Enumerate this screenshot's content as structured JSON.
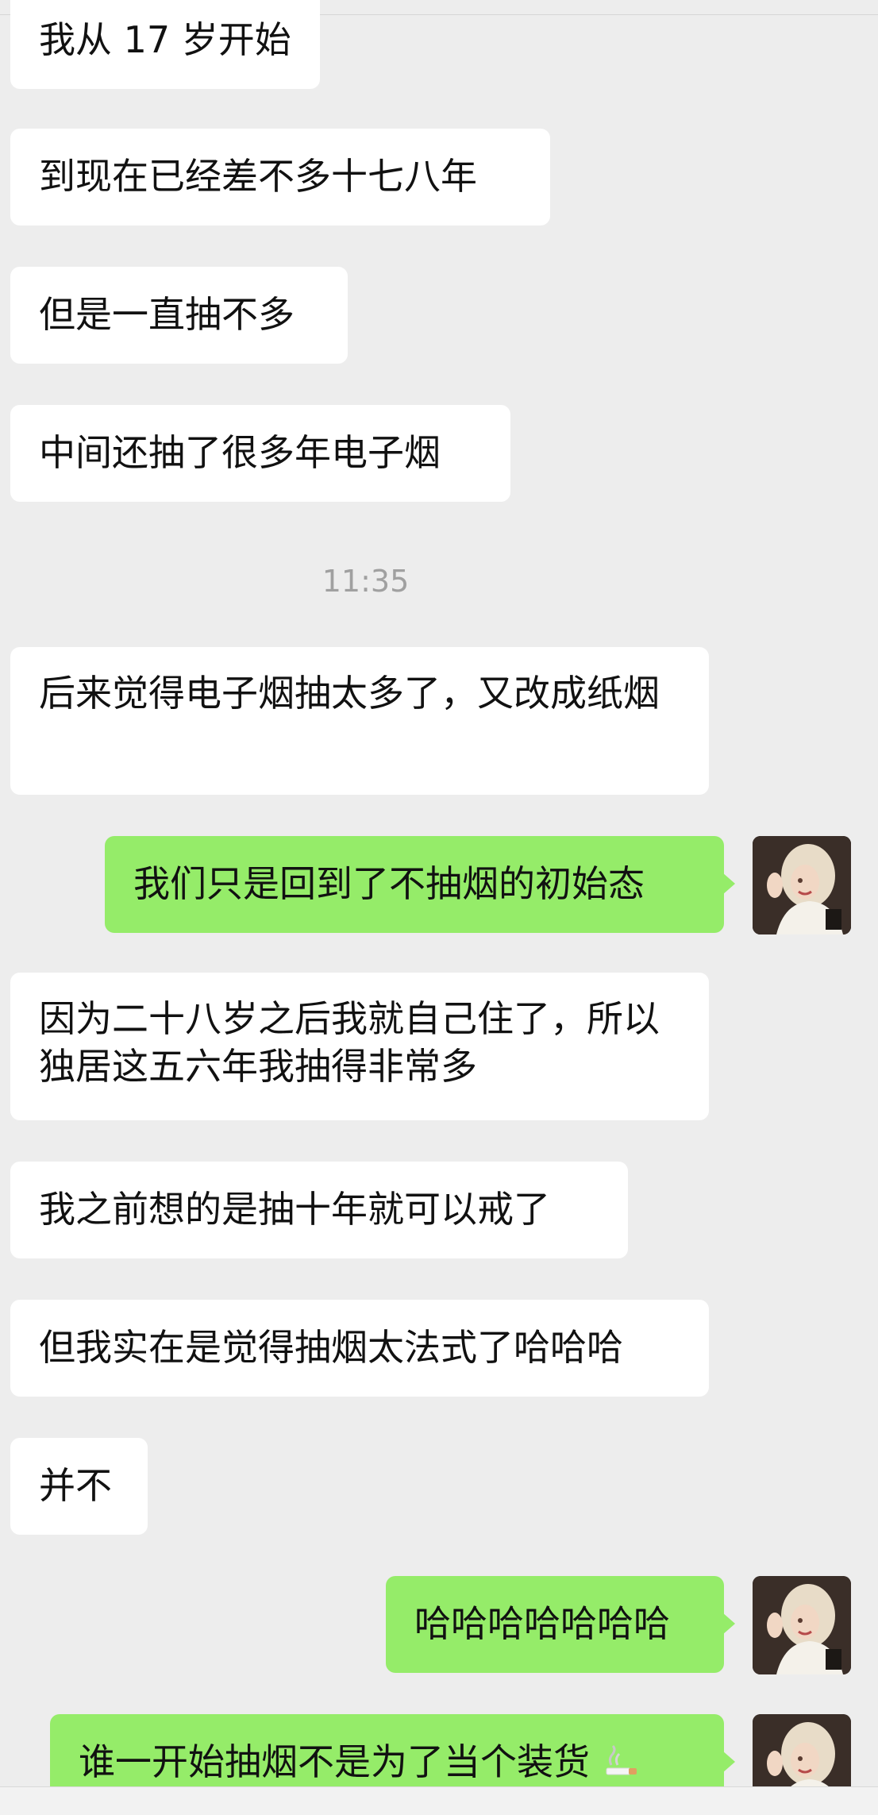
{
  "chat": {
    "messages": [
      {
        "side": "in",
        "text": "我从 17 岁开始"
      },
      {
        "side": "in",
        "text": "到现在已经差不多十七八年"
      },
      {
        "side": "in",
        "text": "但是一直抽不多"
      },
      {
        "side": "in",
        "text": "中间还抽了很多年电子烟"
      },
      {
        "side": "in",
        "text": "后来觉得电子烟抽太多了，又改成纸烟"
      },
      {
        "side": "out",
        "text": "我们只是回到了不抽烟的初始态"
      },
      {
        "side": "in",
        "text": "因为二十八岁之后我就自己住了，所以独居这五六年我抽得非常多"
      },
      {
        "side": "in",
        "text": "我之前想的是抽十年就可以戒了"
      },
      {
        "side": "in",
        "text": "但我实在是觉得抽烟太法式了哈哈哈"
      },
      {
        "side": "in",
        "text": "并不"
      },
      {
        "side": "out",
        "text": "哈哈哈哈哈哈哈"
      },
      {
        "side": "out",
        "text": "谁一开始抽烟不是为了当个装货",
        "emoji": "cigarette-emoji"
      }
    ],
    "timestamp": "11:35"
  },
  "colors": {
    "background": "#ededed",
    "incoming_bubble": "#ffffff",
    "outgoing_bubble": "#95ec69",
    "timestamp_text": "#a0a0a0"
  },
  "icons": {
    "avatar": "user-avatar-photo",
    "emoji": "cigarette-emoji"
  }
}
